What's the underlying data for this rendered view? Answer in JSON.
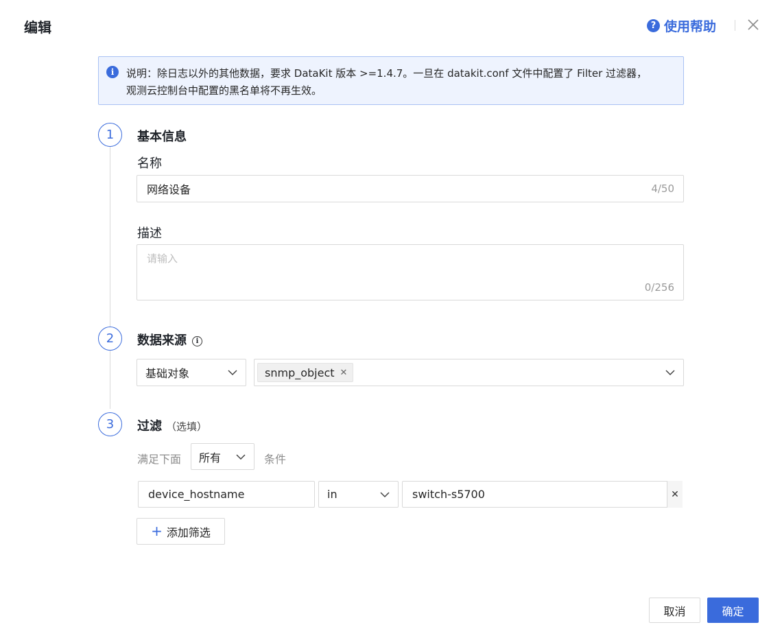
{
  "dialog": {
    "title": "编辑",
    "help_label": "使用帮助"
  },
  "notice": {
    "line1": "说明：除日志以外的其他数据，要求 DataKit 版本 >=1.4.7。一旦在 datakit.conf 文件中配置了 Filter 过滤器，",
    "line2": "观测云控制台中配置的黑名单将不再生效。"
  },
  "steps": [
    {
      "number": "1",
      "title": "基本信息"
    },
    {
      "number": "2",
      "title": "数据来源"
    },
    {
      "number": "3",
      "title": "过滤",
      "subtitle": "（选填）"
    }
  ],
  "basic": {
    "name_label": "名称",
    "name_value": "网络设备",
    "name_counter": "4/50",
    "desc_label": "描述",
    "desc_placeholder": "请输入",
    "desc_counter": "0/256"
  },
  "source": {
    "type_value": "基础对象",
    "tags": [
      "snmp_object"
    ]
  },
  "filter": {
    "prefix": "满足下面",
    "match_value": "所有",
    "suffix": "条件",
    "rows": [
      {
        "field": "device_hostname",
        "operator": "in",
        "value": "switch-s5700"
      }
    ],
    "add_label": "添加筛选"
  },
  "footer": {
    "cancel_label": "取消",
    "ok_label": "确定"
  },
  "colors": {
    "accent": "#3a6bdc",
    "notice_bg": "#eef3fe",
    "border": "#d9d9d9"
  }
}
